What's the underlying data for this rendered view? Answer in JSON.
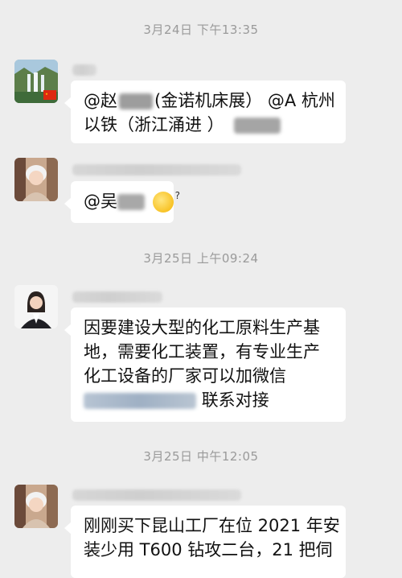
{
  "chat": {
    "messages": [
      {
        "timestamp": "3月24日 下午13:35"
      },
      {
        "prefix1": "@赵",
        "suffix1": "(金诺机床展） @A 杭州",
        "line2": "以铁（浙江涌进 ）"
      },
      {
        "prefix": "@吴"
      },
      {
        "timestamp": "3月25日 上午09:24"
      },
      {
        "line1": "因要建设大型的化工原料生产基",
        "line2": "地，需要化工装置，有专业生产",
        "line3": "化工设备的厂家可以加微信",
        "line4_suffix": "联系对接"
      },
      {
        "timestamp": "3月25日 中午12:05"
      },
      {
        "line1": "刚刚买下昆山工厂在位 2021 年安",
        "line2": "装少用 T600 钻攻二台，21 把伺"
      }
    ]
  },
  "icons": {
    "avatar1": "landscape-waterfall-avatar-with-cn-flag",
    "avatar2": "woman-avatar",
    "avatar3": "woman-business-avatar",
    "avatar4": "woman-avatar",
    "emoji": "thinking-face-emoji"
  },
  "colors": {
    "background": "#ededed",
    "bubble": "#ffffff",
    "timestamp": "#9a9a9a",
    "text": "#111111"
  }
}
